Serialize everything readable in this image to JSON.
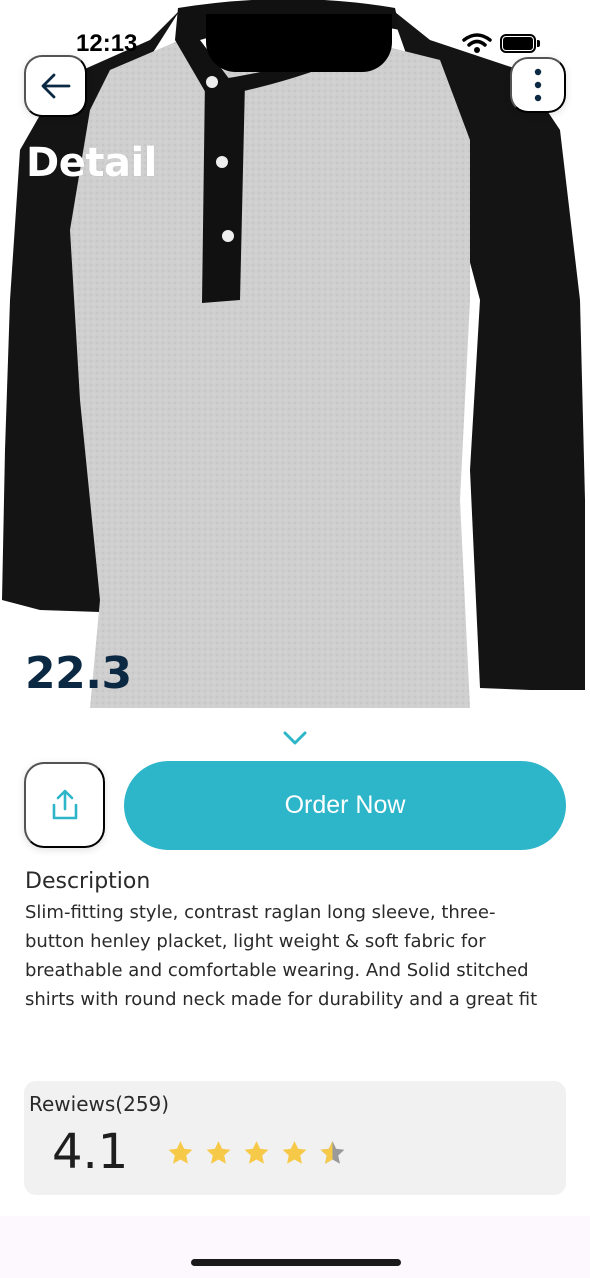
{
  "status_bar": {
    "time": "12:13"
  },
  "header": {
    "title": "Detail",
    "back_icon": "arrow-left-icon",
    "menu_icon": "more-vertical-icon"
  },
  "product": {
    "price": "22.3",
    "image": "raglan-henley-shirt-image",
    "colors": {
      "body": "#cfcfcf",
      "sleeves": "#111111"
    }
  },
  "actions": {
    "expand_icon": "chevron-down-icon",
    "share_icon": "share-icon",
    "order_label": "Order Now",
    "accent": "#2db5c9"
  },
  "description": {
    "title": "Description",
    "lines": [
      "Slim-fitting style, contrast raglan long sleeve, three-",
      "button henley placket, light weight & soft fabric for",
      "breathable and comfortable wearing. And Solid stitched",
      "shirts with round neck made for durability and a great fit"
    ]
  },
  "reviews": {
    "title": "Rewiews(259)",
    "rating": "4.1",
    "stars": 4.5,
    "star_color": "#f7c948"
  }
}
